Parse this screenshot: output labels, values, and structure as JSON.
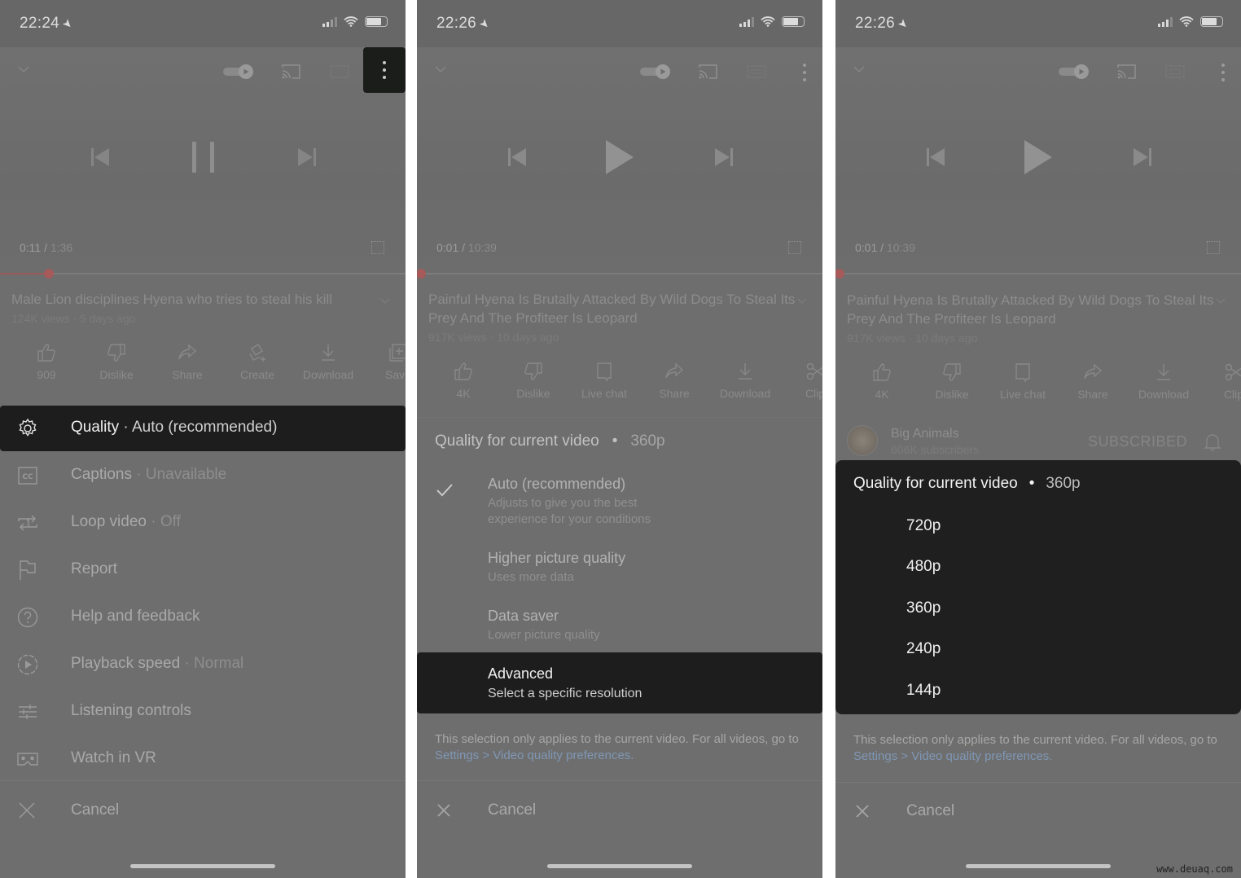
{
  "panels": [
    {
      "status_time": "22:24",
      "video": {
        "elapsed": "0:11",
        "duration": "1:36",
        "progress_fraction": 0.12,
        "state": "playing",
        "title": "Male Lion disciplines Hyena who tries to steal his kill",
        "subtitle": "124K views · 5 days ago"
      },
      "actions": [
        {
          "icon": "thumbs-up-icon",
          "label": "909"
        },
        {
          "icon": "thumbs-down-icon",
          "label": "Dislike"
        },
        {
          "icon": "share-icon",
          "label": "Share"
        },
        {
          "icon": "create-icon",
          "label": "Create"
        },
        {
          "icon": "download-icon",
          "label": "Download"
        },
        {
          "icon": "save-icon",
          "label": "Save"
        }
      ],
      "menu": [
        {
          "icon": "gear-icon",
          "label": "Quality",
          "value": "Auto (recommended)",
          "highlighted": true
        },
        {
          "icon": "captions-icon",
          "label": "Captions",
          "value": "Unavailable"
        },
        {
          "icon": "loop-icon",
          "label": "Loop video",
          "value": "Off"
        },
        {
          "icon": "flag-icon",
          "label": "Report",
          "value": ""
        },
        {
          "icon": "help-icon",
          "label": "Help and feedback",
          "value": ""
        },
        {
          "icon": "playback-speed-icon",
          "label": "Playback speed",
          "value": "Normal"
        },
        {
          "icon": "sliders-icon",
          "label": "Listening controls",
          "value": ""
        },
        {
          "icon": "vr-icon",
          "label": "Watch in VR",
          "value": ""
        }
      ],
      "cancel": "Cancel"
    },
    {
      "status_time": "22:26",
      "video": {
        "elapsed": "0:01",
        "duration": "10:39",
        "progress_fraction": 0.01,
        "state": "paused",
        "title": "Painful Hyena Is Brutally Attacked By Wild Dogs To Steal Its Prey And The Profiteer Is Leopard",
        "subtitle": "917K views · 10 days ago"
      },
      "actions": [
        {
          "icon": "thumbs-up-icon",
          "label": "4K"
        },
        {
          "icon": "thumbs-down-icon",
          "label": "Dislike"
        },
        {
          "icon": "live-chat-icon",
          "label": "Live chat"
        },
        {
          "icon": "share-icon",
          "label": "Share"
        },
        {
          "icon": "download-icon",
          "label": "Download"
        },
        {
          "icon": "clip-icon",
          "label": "Clip"
        }
      ],
      "quality": {
        "heading": "Quality for current video",
        "current": "360p",
        "options": [
          {
            "title": "Auto (recommended)",
            "desc": "Adjusts to give you the best experience for your conditions",
            "checked": true
          },
          {
            "title": "Higher picture quality",
            "desc": "Uses more data"
          },
          {
            "title": "Data saver",
            "desc": "Lower picture quality"
          },
          {
            "title": "Advanced",
            "desc": "Select a specific resolution",
            "highlighted": true
          }
        ],
        "note_prefix": "This selection only applies to the current video. For all videos, go to ",
        "note_link": "Settings > Video quality preferences."
      },
      "cancel": "Cancel"
    },
    {
      "status_time": "22:26",
      "video": {
        "elapsed": "0:01",
        "duration": "10:39",
        "progress_fraction": 0.01,
        "state": "paused",
        "title": "Painful Hyena Is Brutally Attacked By Wild Dogs To Steal Its Prey And The Profiteer Is Leopard",
        "subtitle": "917K views · 10 days ago"
      },
      "actions": [
        {
          "icon": "thumbs-up-icon",
          "label": "4K"
        },
        {
          "icon": "thumbs-down-icon",
          "label": "Dislike"
        },
        {
          "icon": "live-chat-icon",
          "label": "Live chat"
        },
        {
          "icon": "share-icon",
          "label": "Share"
        },
        {
          "icon": "download-icon",
          "label": "Download"
        },
        {
          "icon": "clip-icon",
          "label": "Clip"
        }
      ],
      "channel": {
        "name": "Big Animals",
        "subscribers": "606K subscribers",
        "subscribe_state": "SUBSCRIBED"
      },
      "resolutions": {
        "heading": "Quality for current video",
        "current": "360p",
        "options": [
          "720p",
          "480p",
          "360p",
          "240p",
          "144p"
        ]
      },
      "note_prefix": "This selection only applies to the current video. For all videos, go to ",
      "note_link": "Settings > Video quality preferences.",
      "cancel": "Cancel"
    }
  ],
  "separator": "·",
  "watermark": "www.deuaq.com",
  "colors": {
    "dim_overlay": "#6e6e6e",
    "highlight_bg": "#1d1d1d",
    "link": "#7f97b5",
    "progress": "#a65a5a"
  }
}
